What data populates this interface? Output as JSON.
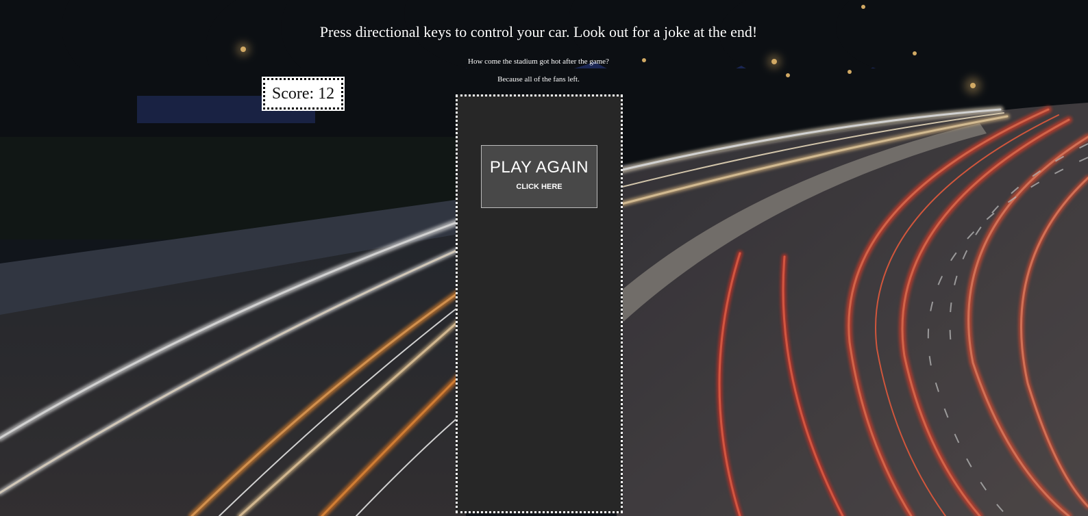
{
  "game": {
    "instructions": "Press directional keys to control your car. Look out for a joke at the end!",
    "joke_question": "How come the stadium got hot after the game?",
    "joke_answer": "Because all of the fans left.",
    "score_text": "Score: 12",
    "play_again_label": "PLAY AGAIN",
    "play_again_sub": "CLICK HERE"
  },
  "colors": {
    "game_area_bg": "#272727",
    "button_bg": "#484848",
    "score_bg": "#ffffff",
    "text": "#ffffff"
  }
}
